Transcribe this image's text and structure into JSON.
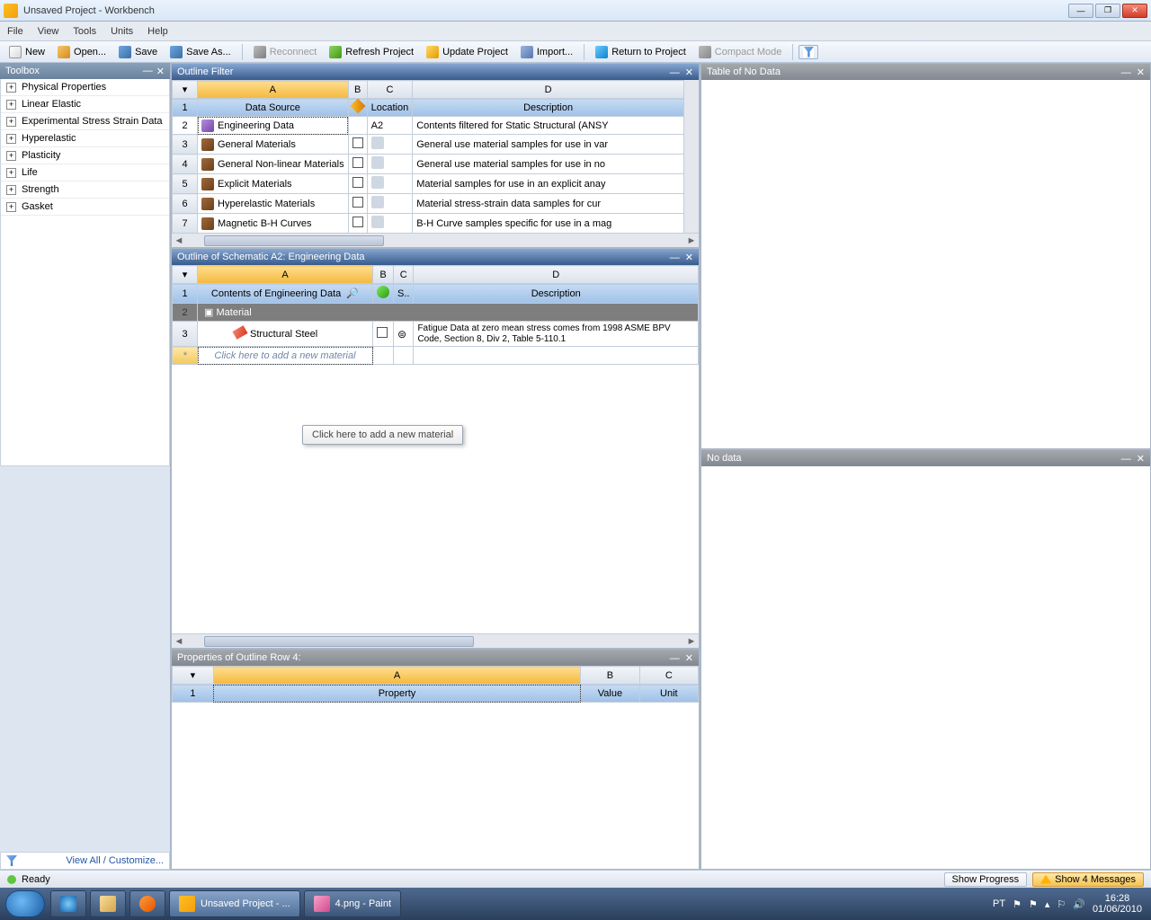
{
  "title": "Unsaved Project - Workbench",
  "menu": [
    "File",
    "View",
    "Tools",
    "Units",
    "Help"
  ],
  "toolbar": {
    "new": "New",
    "open": "Open...",
    "save": "Save",
    "saveas": "Save As...",
    "reconnect": "Reconnect",
    "refresh": "Refresh Project",
    "update": "Update Project",
    "import": "Import...",
    "return": "Return to Project",
    "compact": "Compact Mode"
  },
  "toolbox": {
    "title": "Toolbox",
    "items": [
      "Physical Properties",
      "Linear Elastic",
      "Experimental Stress Strain Data",
      "Hyperelastic",
      "Plasticity",
      "Life",
      "Strength",
      "Gasket"
    ],
    "footer": "View All / Customize..."
  },
  "outlineFilter": {
    "title": "Outline Filter",
    "cols": {
      "a": "A",
      "b": "B",
      "c": "C",
      "d": "D"
    },
    "hdr": {
      "a": "Data Source",
      "c": "Location",
      "d": "Description"
    },
    "rows": [
      {
        "n": "2",
        "a": "Engineering Data",
        "c": "A2",
        "d": "Contents filtered for Static Structural (ANSY"
      },
      {
        "n": "3",
        "a": "General Materials",
        "d": "General use material samples for use in var"
      },
      {
        "n": "4",
        "a": "General Non-linear Materials",
        "d": "General use material samples for use in no"
      },
      {
        "n": "5",
        "a": "Explicit Materials",
        "d": "Material samples for use in an explicit anay"
      },
      {
        "n": "6",
        "a": "Hyperelastic Materials",
        "d": "Material stress-strain data samples for cur"
      },
      {
        "n": "7",
        "a": "Magnetic B-H Curves",
        "d": "B-H Curve samples specific for use in a mag"
      }
    ]
  },
  "schematic": {
    "title": "Outline of Schematic A2: Engineering Data",
    "cols": {
      "a": "A",
      "b": "B",
      "c": "C",
      "d": "D"
    },
    "hdr": {
      "a": "Contents of Engineering Data",
      "c": "S..",
      "d": "Description"
    },
    "matHdr": "Material",
    "row": {
      "n": "3",
      "a": "Structural Steel",
      "d": "Fatigue Data at zero mean stress comes from 1998 ASME BPV Code, Section 8, Div 2, Table 5-110.1"
    },
    "addRow": "Click here to add a new material",
    "tooltip": "Click here to add a new material"
  },
  "props": {
    "title": "Properties of Outline Row 4:",
    "cols": {
      "a": "A",
      "b": "B",
      "c": "C"
    },
    "hdr": {
      "a": "Property",
      "b": "Value",
      "c": "Unit"
    }
  },
  "tableOfNoData": {
    "title": "Table of No Data"
  },
  "noData": {
    "title": "No data"
  },
  "status": {
    "ready": "Ready",
    "showProgress": "Show Progress",
    "showMessages": "Show 4 Messages"
  },
  "taskbar": {
    "app1": "Unsaved Project - ...",
    "app2": "4.png - Paint",
    "lang": "PT",
    "time": "16:28",
    "date": "01/06/2010"
  }
}
